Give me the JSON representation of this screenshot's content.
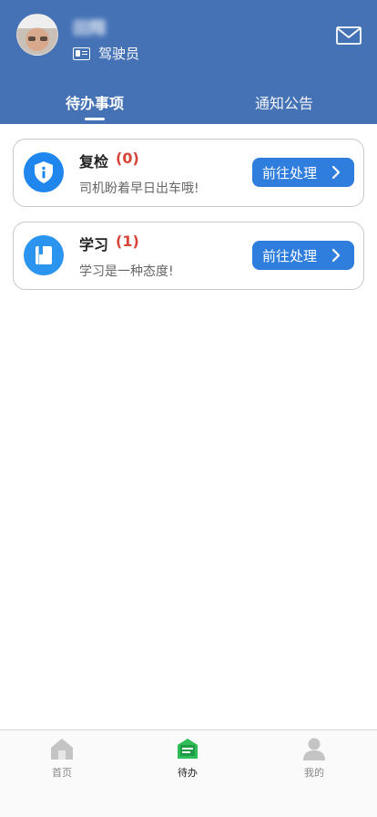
{
  "header": {
    "username": "田翔",
    "role": "驾驶员",
    "tabs": [
      {
        "label": "待办事项",
        "active": true
      },
      {
        "label": "通知公告",
        "active": false
      }
    ]
  },
  "tasks": [
    {
      "title": "复检",
      "count": "(0)",
      "desc": "司机盼着早日出车哦!",
      "button": "前往处理",
      "icon": "shield-info-icon"
    },
    {
      "title": "学习",
      "count": "(1)",
      "desc": "学习是一种态度!",
      "button": "前往处理",
      "icon": "book-icon"
    }
  ],
  "bottom_nav": [
    {
      "label": "首页",
      "icon": "home-icon"
    },
    {
      "label": "待办",
      "icon": "todo-icon",
      "active": true
    },
    {
      "label": "我的",
      "icon": "user-icon"
    }
  ],
  "colors": {
    "header_bg": "#4472b5",
    "accent": "#2f7ddd",
    "count_red": "#d9443a",
    "active_nav": "#2ebd59"
  }
}
